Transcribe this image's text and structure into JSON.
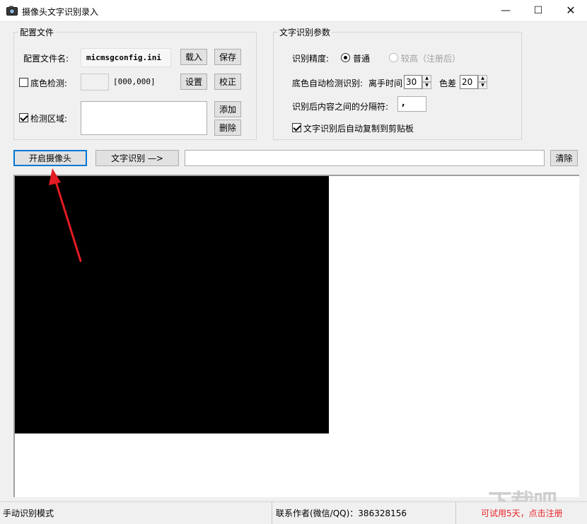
{
  "window": {
    "title": "摄像头文字识别录入",
    "icon": "camera-icon",
    "controls": {
      "minimize": "—",
      "maximize": "☐",
      "close": "✕"
    }
  },
  "config_group": {
    "legend": "配置文件",
    "file_label": "配置文件名:",
    "file_value": "micmsgconfig.ini",
    "load_button": "载入",
    "save_button": "保存",
    "bgcolor_check_label": "底色检测:",
    "bgcolor_checked": false,
    "bgcolor_value": "[000,000]",
    "set_button": "设置",
    "calibrate_button": "校正",
    "region_check_label": "检测区域:",
    "region_checked": true,
    "add_button": "添加",
    "delete_button": "删除"
  },
  "ocr_group": {
    "legend": "文字识别参数",
    "precision_label": "识别精度:",
    "precision_normal": "普通",
    "precision_high": "较高（注册后）",
    "auto_detect_label": "底色自动检测识别:",
    "leave_time_label": "离手时间",
    "leave_time_value": "30",
    "color_diff_label": "色差",
    "color_diff_value": "20",
    "separator_label": "识别后内容之间的分隔符:",
    "separator_value": ",",
    "auto_copy_label": "文字识别后自动复制到剪贴板",
    "auto_copy_checked": true
  },
  "toolbar": {
    "open_camera": "开启摄像头",
    "recognize": "文字识别 —>",
    "result_value": "",
    "clear": "清除"
  },
  "status": {
    "mode": "手动识别模式",
    "contact": "联系作者(微信/QQ)：386328156",
    "trial": "可试用5天，点击注册"
  },
  "watermark": "下载吧",
  "colors": {
    "accent": "#0078d7",
    "trial_text": "#e8262a",
    "annotation_arrow": "#e31b23"
  }
}
